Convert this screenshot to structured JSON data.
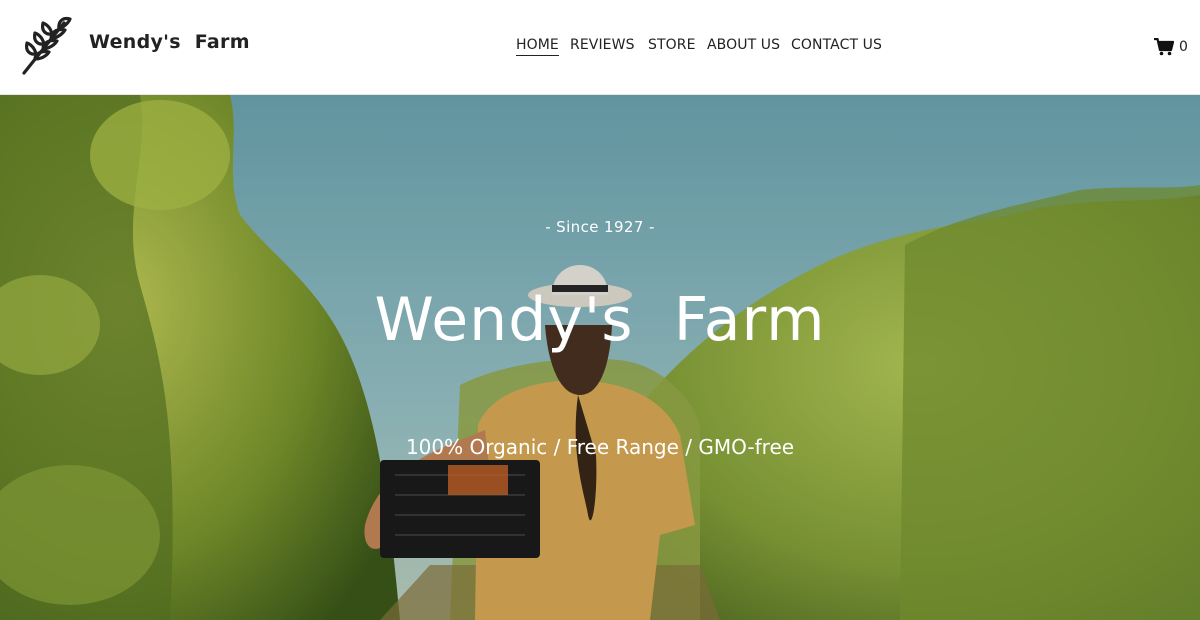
{
  "header": {
    "site_title": "Wendy's  Farm",
    "logo_icon": "leaf-branch-icon",
    "nav": [
      {
        "label": "HOME",
        "active": true
      },
      {
        "label": "REVIEWS",
        "active": false
      },
      {
        "label": "STORE",
        "active": false
      },
      {
        "label": "ABOUT US",
        "active": false
      },
      {
        "label": "CONTACT US",
        "active": false
      }
    ],
    "cart": {
      "icon": "shopping-cart-icon",
      "count": "0"
    }
  },
  "hero": {
    "since": "- Since 1927 -",
    "title": "Wendy's  Farm",
    "tagline": "100% Organic / Free Range / GMO-free",
    "background": "woman-in-vineyard-photo"
  },
  "colors": {
    "text": "#222222",
    "hero_text": "#ffffff",
    "sky": "#7fb3bd",
    "foliage": "#8aa540"
  }
}
